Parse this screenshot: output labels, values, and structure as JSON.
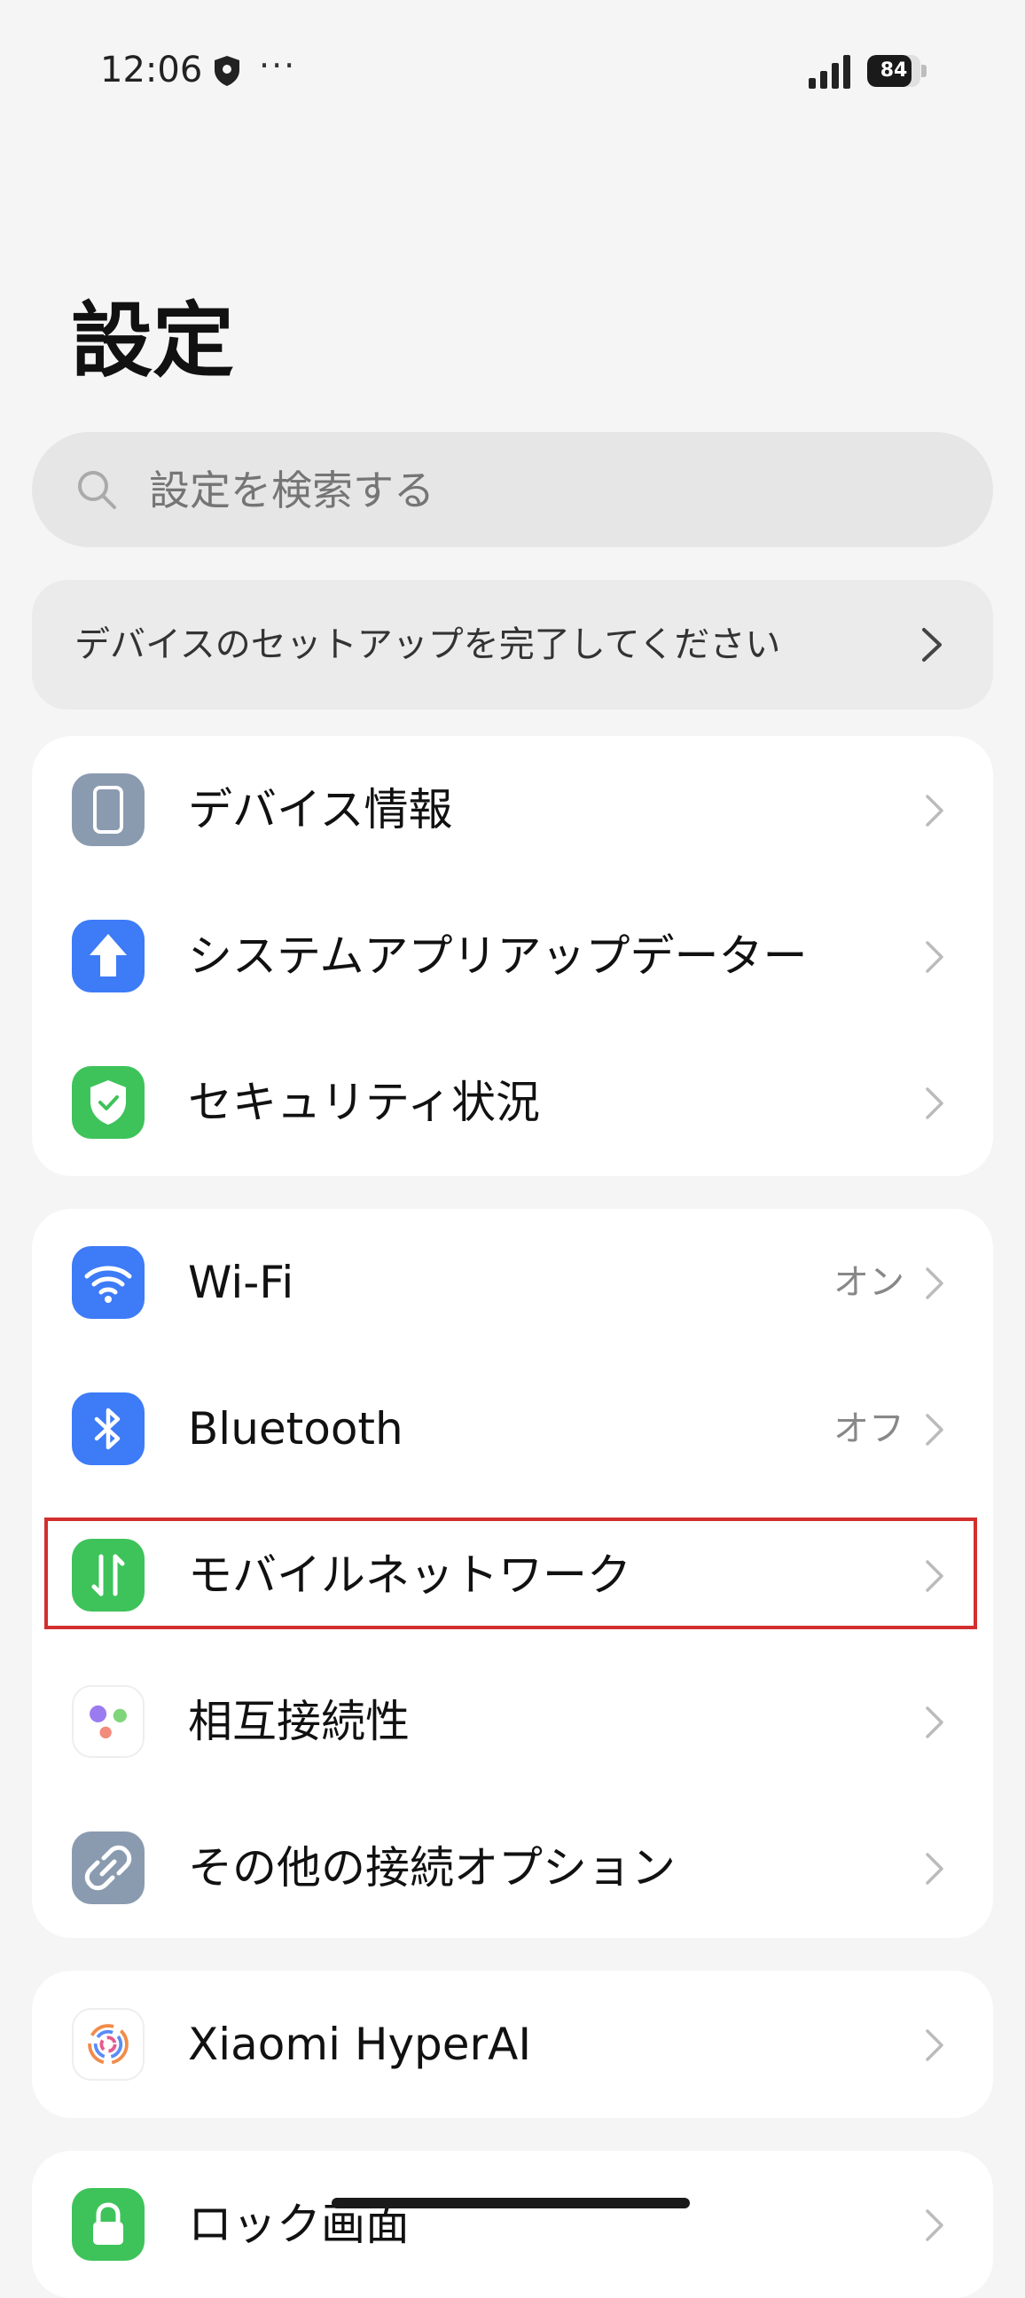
{
  "status_bar": {
    "time": "12:06",
    "dots": "···",
    "battery_level": "84",
    "battery_fraction": 0.84
  },
  "page_title": "設定",
  "search": {
    "placeholder": "設定を検索する",
    "value": ""
  },
  "setup_banner": {
    "label": "デバイスのセットアップを完了してください"
  },
  "groups": [
    {
      "items": [
        {
          "label": "デバイス情報",
          "icon": "phone-icon",
          "color": "#8a9bb0"
        },
        {
          "label": "システムアプリアップデーター",
          "icon": "upload-arrow-icon",
          "color": "#3d7bf7"
        },
        {
          "label": "セキュリティ状況",
          "icon": "shield-check-icon",
          "color": "#3ec35a"
        }
      ]
    },
    {
      "items": [
        {
          "label": "Wi-Fi",
          "value": "オン",
          "icon": "wifi-icon",
          "color": "#3d7bf7"
        },
        {
          "label": "Bluetooth",
          "value": "オフ",
          "icon": "bluetooth-icon",
          "color": "#3d7bf7"
        },
        {
          "label": "モバイルネットワーク",
          "icon": "mobile-data-icon",
          "color": "#3ec35a"
        },
        {
          "label": "相互接続性",
          "icon": "interconnect-dots-icon",
          "color": "#ffffff"
        },
        {
          "label": "その他の接続オプション",
          "icon": "link-icon",
          "color": "#8a9bb0"
        }
      ]
    },
    {
      "items": [
        {
          "label": "Xiaomi HyperAI",
          "icon": "hyperai-swirl-icon",
          "color": "#ffffff"
        }
      ]
    },
    {
      "items": [
        {
          "label": "ロック画面",
          "icon": "lock-icon",
          "color": "#3ec35a"
        }
      ]
    }
  ]
}
